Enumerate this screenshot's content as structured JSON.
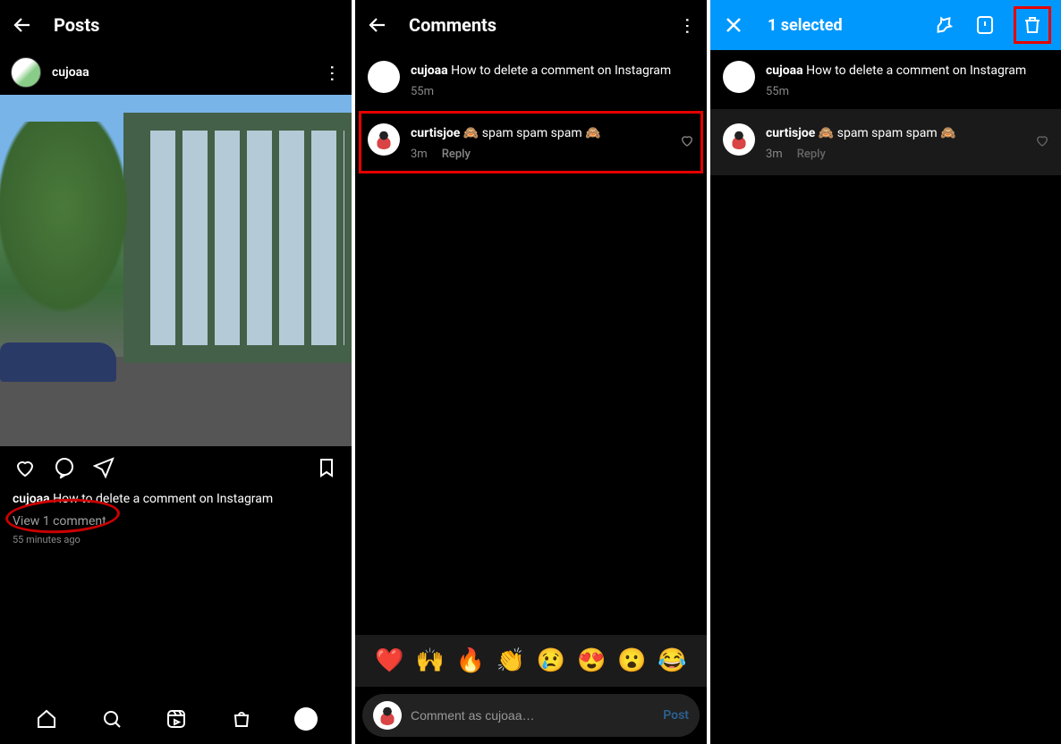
{
  "panel1": {
    "header_title": "Posts",
    "post_user": "cujoaa",
    "caption_user": "cujoaa",
    "caption_text": "How to delete a comment on Instagram",
    "view_comments": "View 1 comment",
    "timestamp": "55 minutes ago"
  },
  "panel2": {
    "header_title": "Comments",
    "post_user": "cujoaa",
    "post_text": "How to delete a comment on Instagram",
    "post_time": "55m",
    "comment_user": "curtisjoe",
    "comment_text": "🙈 spam spam spam 🙈",
    "comment_time": "3m",
    "reply_label": "Reply",
    "emojis": [
      "❤️",
      "🙌",
      "🔥",
      "👏",
      "😢",
      "😍",
      "😮",
      "😂"
    ],
    "compose_placeholder": "Comment as cujoaa…",
    "post_button": "Post"
  },
  "panel3": {
    "header_title": "1 selected",
    "post_user": "cujoaa",
    "post_text": "How to delete a comment on Instagram",
    "post_time": "55m",
    "comment_user": "curtisjoe",
    "comment_text": "🙈 spam spam spam 🙈",
    "comment_time": "3m",
    "reply_label": "Reply"
  }
}
